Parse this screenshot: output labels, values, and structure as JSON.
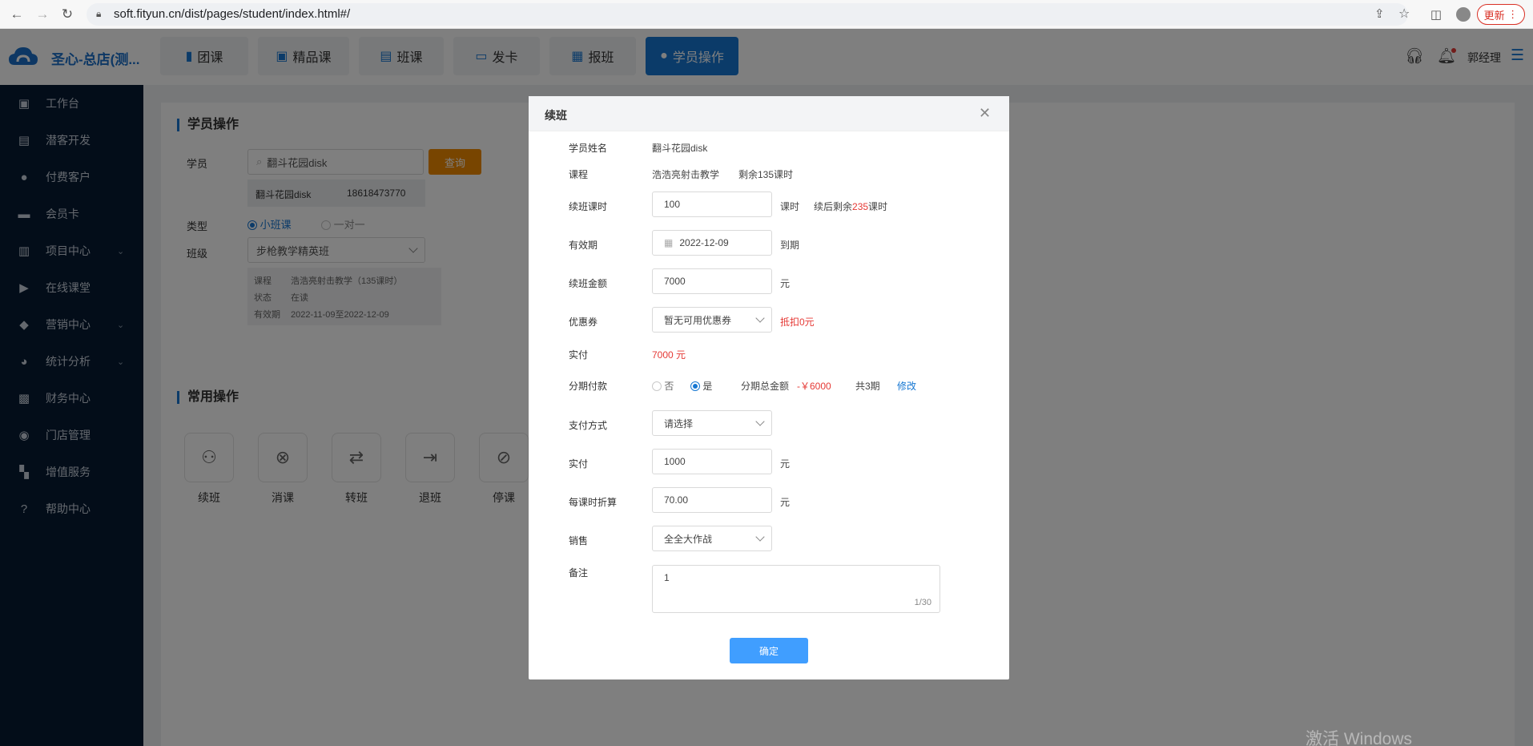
{
  "browser": {
    "url": "soft.fityun.cn/dist/pages/student/index.html#/",
    "update_label": "更新"
  },
  "header": {
    "brand": "圣心-总店(测...",
    "tabs": [
      {
        "label": "团课",
        "icon": "book-icon"
      },
      {
        "label": "精品课",
        "icon": "image-icon"
      },
      {
        "label": "班课",
        "icon": "screen-icon"
      },
      {
        "label": "发卡",
        "icon": "card-icon"
      },
      {
        "label": "报班",
        "icon": "enroll-icon"
      },
      {
        "label": "学员操作",
        "icon": "user-icon",
        "active": true
      }
    ],
    "user_name": "郭经理"
  },
  "sidebar": {
    "items": [
      {
        "label": "工作台",
        "icon": "dashboard-icon"
      },
      {
        "label": "潜客开发",
        "icon": "contacts-icon"
      },
      {
        "label": "付费客户",
        "icon": "users-icon"
      },
      {
        "label": "会员卡",
        "icon": "card-icon"
      },
      {
        "label": "项目中心",
        "icon": "project-icon"
      },
      {
        "label": "在线课堂",
        "icon": "video-icon"
      },
      {
        "label": "营销中心",
        "icon": "tag-icon"
      },
      {
        "label": "统计分析",
        "icon": "pie-icon"
      },
      {
        "label": "财务中心",
        "icon": "wallet-icon"
      },
      {
        "label": "门店管理",
        "icon": "store-icon"
      },
      {
        "label": "增值服务",
        "icon": "apps-icon"
      },
      {
        "label": "帮助中心",
        "icon": "help-icon"
      }
    ]
  },
  "student_panel": {
    "title": "学员操作",
    "student_label": "学员",
    "student_search_value": "翻斗花园disk",
    "query_button": "查询",
    "result_name": "翻斗花园disk",
    "result_phone": "18618473770",
    "type_label": "类型",
    "type_option_1": "小班课",
    "type_option_2": "一对一",
    "class_label": "班级",
    "class_value": "步枪教学精英班",
    "info_course_label": "课程",
    "info_course_value": "浩浩亮射击教学（135课时）",
    "info_status_label": "状态",
    "info_status_value": "在读",
    "info_valid_label": "有效期",
    "info_valid_value": "2022-11-09至2022-12-09"
  },
  "common_ops": {
    "title": "常用操作",
    "items": [
      {
        "label": "续班",
        "icon": "renew-icon"
      },
      {
        "label": "消课",
        "icon": "cancel-icon"
      },
      {
        "label": "转班",
        "icon": "transfer-icon"
      },
      {
        "label": "退班",
        "icon": "exit-icon"
      },
      {
        "label": "停课",
        "icon": "pause-icon"
      }
    ]
  },
  "watermark": "激活 Windows",
  "modal": {
    "title": "续班",
    "student_name_label": "学员姓名",
    "student_name_value": "翻斗花园disk",
    "course_label": "课程",
    "course_value": "浩浩亮射击教学",
    "course_remaining": "剩余135课时",
    "hours_label": "续班课时",
    "hours_value": "100",
    "hours_unit": "课时",
    "after_renew_prefix": "续后剩余",
    "after_renew_value": "235",
    "after_renew_suffix": "课时",
    "valid_label": "有效期",
    "valid_value": "2022-12-09",
    "valid_suffix": "到期",
    "amount_label": "续班金额",
    "amount_value": "7000",
    "amount_unit": "元",
    "coupon_label": "优惠券",
    "coupon_value": "暂无可用优惠券",
    "coupon_deduct": "抵扣0元",
    "paid_label": "实付",
    "paid_value": "7000 元",
    "installment_label": "分期付款",
    "installment_no": "否",
    "installment_yes": "是",
    "installment_total_label": "分期总金额",
    "installment_total_value": "-￥6000",
    "installment_periods": "共3期",
    "installment_edit": "修改",
    "pay_method_label": "支付方式",
    "pay_method_placeholder": "请选择",
    "actual_label": "实付",
    "actual_value": "1000",
    "actual_unit": "元",
    "per_hour_label": "每课时折算",
    "per_hour_value": "70.00",
    "per_hour_unit": "元",
    "sales_label": "销售",
    "sales_value": "全全大作战",
    "remark_label": "备注",
    "remark_value": "1",
    "remark_count": "1/30",
    "confirm": "确定"
  }
}
